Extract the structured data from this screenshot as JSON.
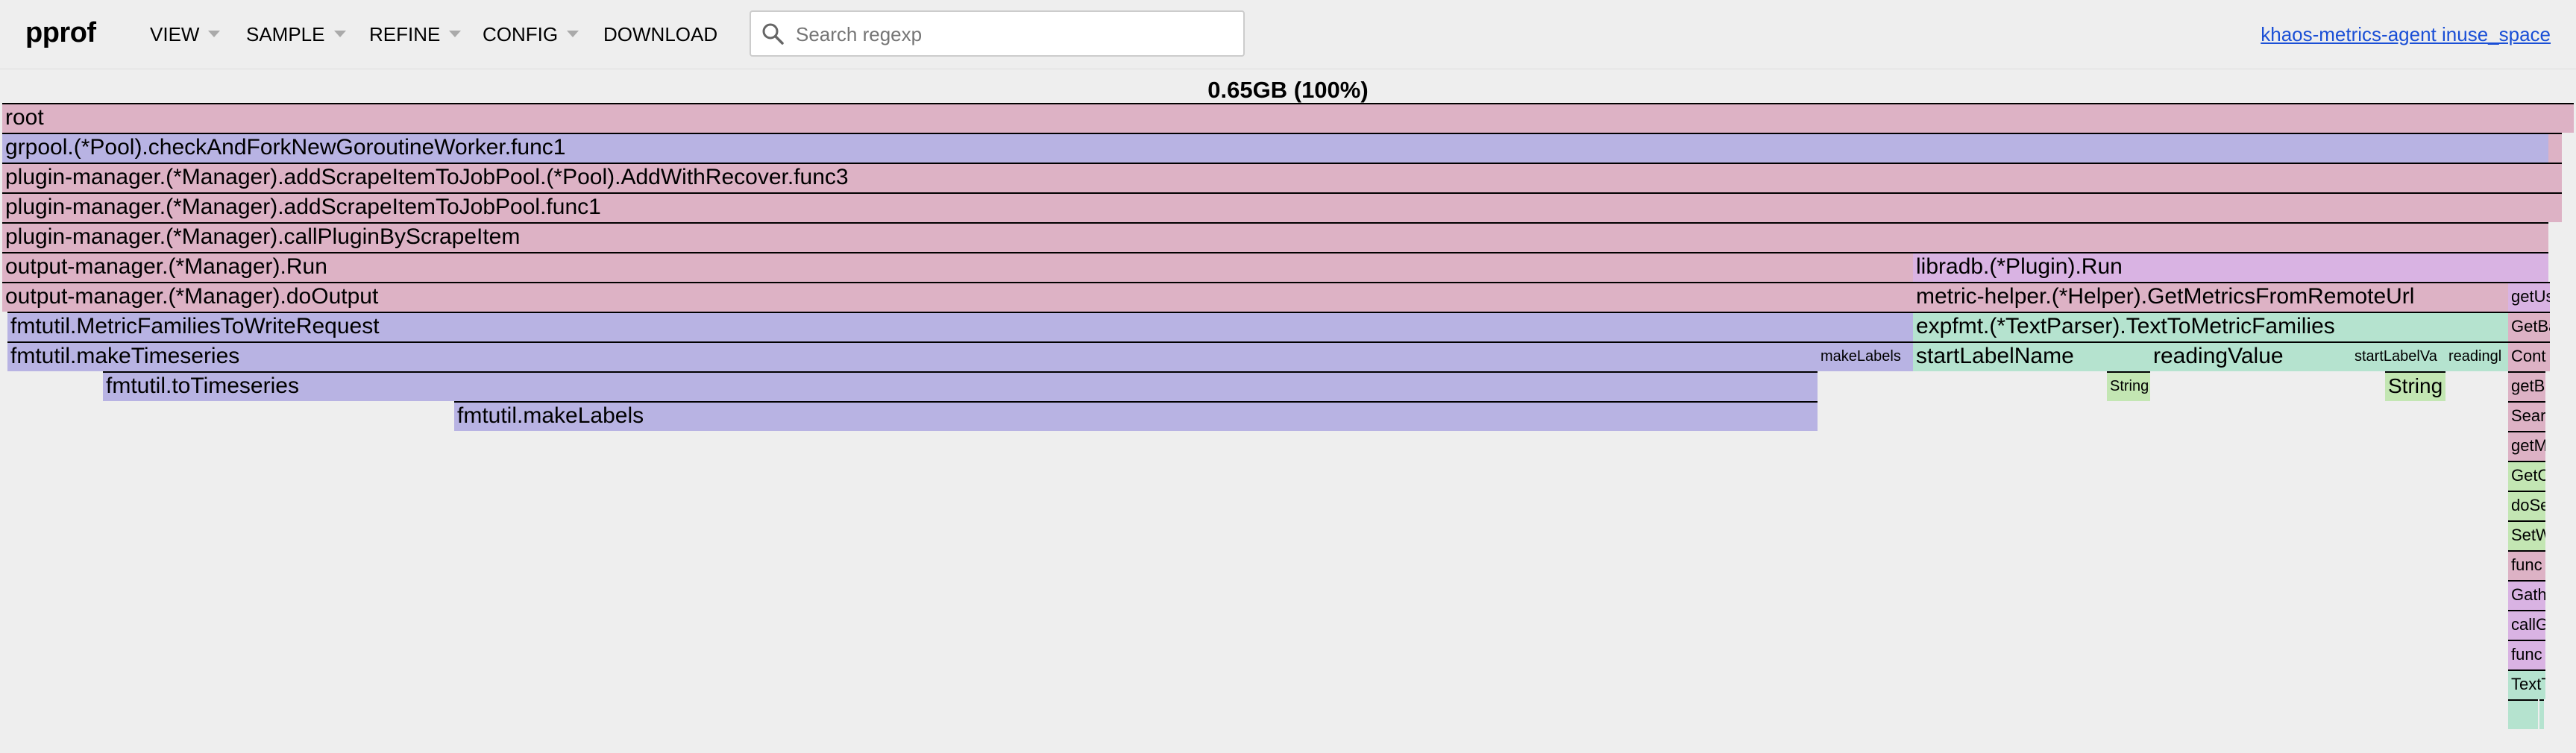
{
  "app": {
    "logo": "pprof",
    "menu": [
      "VIEW",
      "SAMPLE",
      "REFINE",
      "CONFIG",
      "DOWNLOAD"
    ],
    "search_placeholder": "Search regexp",
    "search_value": "",
    "profile_link": "khaos-metrics-agent inuse_space"
  },
  "flame": {
    "title": "0.65GB (100%)",
    "colors": {
      "pink": "#ddb2c5",
      "purple": "#b8b3e3",
      "lilac": "#d9b3e3",
      "green": "#b5e3cf",
      "lime": "#c3e6b3"
    },
    "frames": [
      "root",
      "grpool.(*Pool).checkAndForkNewGoroutineWorker.func1",
      "plugin-manager.(*Manager).addScrapeItemToJobPool.(*Pool).AddWithRecover.func3",
      "plugin-manager.(*Manager).addScrapeItemToJobPool.func1",
      "plugin-manager.(*Manager).callPluginByScrapeItem",
      "output-manager.(*Manager).Run",
      "libradb.(*Plugin).Run",
      "output-manager.(*Manager).doOutput",
      "metric-helper.(*Helper).GetMetricsFromRemoteUrl",
      "getUs",
      "fmtutil.MetricFamiliesToWriteRequest",
      "expfmt.(*TextParser).TextToMetricFamilies",
      "GetBa",
      "fmtutil.makeTimeseries",
      "makeLabels",
      "startLabelName",
      "readingValue",
      "startLabelVa",
      "readingl",
      "Cont",
      "fmtutil.toTimeseries",
      "String",
      "String",
      "getB",
      "fmtutil.makeLabels",
      "Sear",
      "getM",
      "GetC",
      "doSe",
      "SetW",
      "func",
      "Gath",
      "callG",
      "func",
      "TextT"
    ]
  }
}
